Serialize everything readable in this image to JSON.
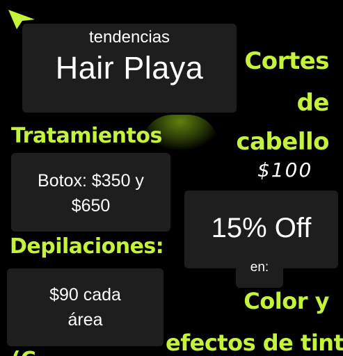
{
  "header": {
    "subtitle": "tendencias",
    "title": "Hair Playa"
  },
  "cortes": {
    "line1": "Cortes",
    "line2": "de",
    "line3": "cabello",
    "price": "$100"
  },
  "promo": {
    "discount": "15% Off",
    "en": "en:",
    "color_line": "Color y",
    "efectos_line": "efectos de tinte:"
  },
  "tratamientos": {
    "heading": "Tratamientos",
    "text": "Botox: $350 y\n$650"
  },
  "depilaciones": {
    "heading": "Depilaciones:",
    "text": "$90 cada\nárea"
  },
  "cut_off_text": "(C",
  "colors": {
    "accent": "#c5f23a",
    "card": "#1e1e1e",
    "background": "#000000"
  },
  "icons": {
    "cursor": "pointer-arrow-icon"
  }
}
